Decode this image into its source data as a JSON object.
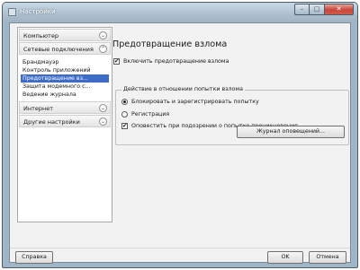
{
  "window": {
    "title": "Настройки",
    "minimize_glyph": "–",
    "maximize_glyph": "□",
    "close_glyph": "✕"
  },
  "sidebar": {
    "categories": [
      {
        "label": "Компьютер",
        "chevron": "⌄"
      },
      {
        "label": "Сетевые подключения",
        "chevron": "⌃"
      },
      {
        "label": "Интернет",
        "chevron": "⌄"
      },
      {
        "label": "Другие настройки",
        "chevron": "⌄"
      }
    ],
    "network_items": [
      {
        "label": "Брандмауэр"
      },
      {
        "label": "Контроль приложений"
      },
      {
        "label": "Предотвращение вз..."
      },
      {
        "label": "Защита модемного с..."
      },
      {
        "label": "Ведение журнала"
      }
    ],
    "selected_item": "Предотвращение вз..."
  },
  "main": {
    "title": "Предотвращение взлома",
    "enable_checkbox": {
      "label": "Включить предотвращение взлома",
      "checked": true
    },
    "group": {
      "title": "Действие в отношении попытки взлома",
      "options": [
        {
          "label": "Блокировать и зарегистрировать попытку",
          "selected": true
        },
        {
          "label": "Регистрация",
          "selected": false
        }
      ],
      "notify_checkbox": {
        "label": "Оповестить при подозрении о попытке проникновения",
        "checked": true
      }
    },
    "journal_button": "Журнал оповещений..."
  },
  "footer": {
    "help_button": "Справка",
    "ok_button": "OK",
    "cancel_button": "Отмена"
  },
  "check_glyph": "✔"
}
